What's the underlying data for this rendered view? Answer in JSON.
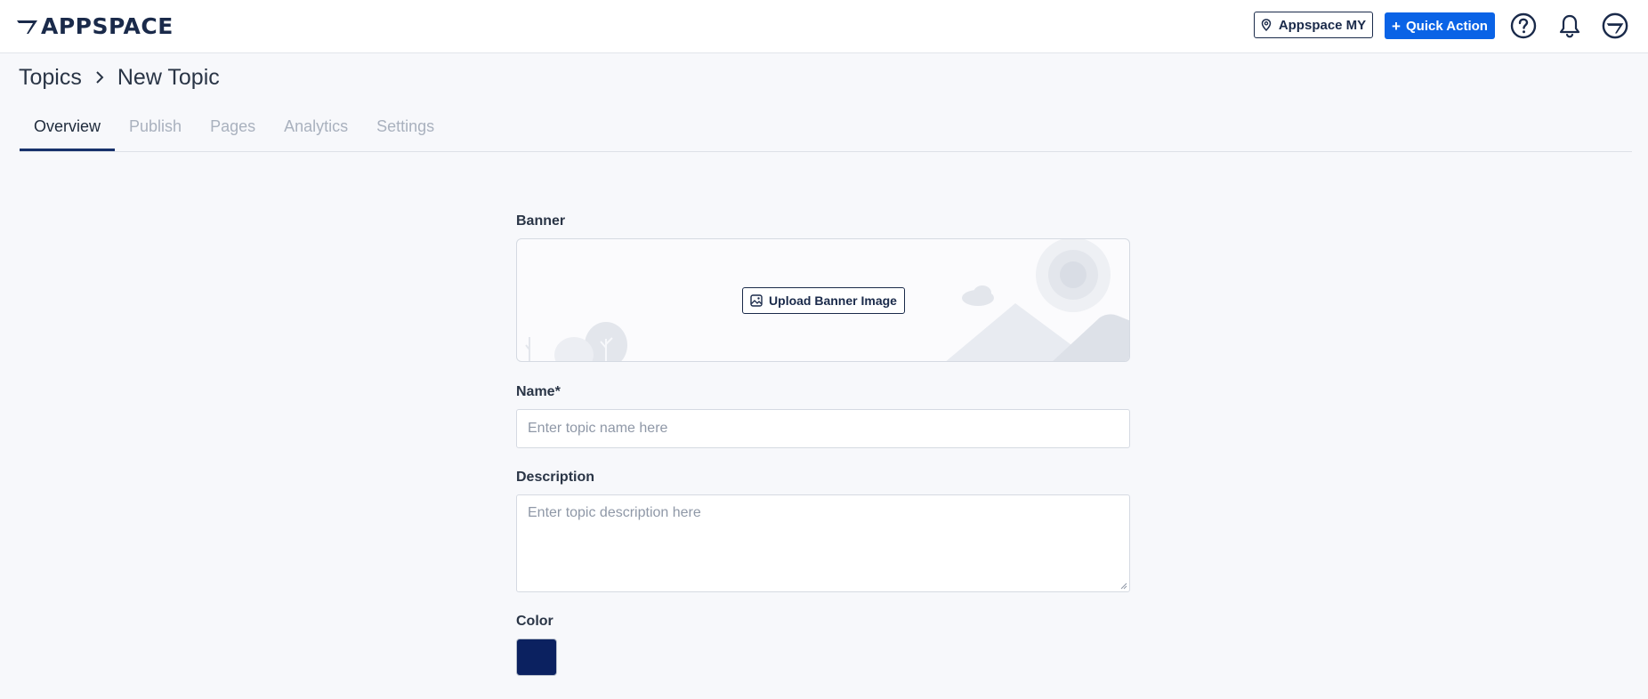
{
  "header": {
    "logo_text": "APPSPACE",
    "location_button": "Appspace MY",
    "quick_action_button": "Quick Action",
    "icons": [
      "help-icon",
      "bell-icon",
      "user-avatar-icon"
    ]
  },
  "breadcrumb": {
    "root": "Topics",
    "current": "New Topic"
  },
  "tabs": [
    {
      "label": "Overview",
      "active": true
    },
    {
      "label": "Publish",
      "active": false
    },
    {
      "label": "Pages",
      "active": false
    },
    {
      "label": "Analytics",
      "active": false
    },
    {
      "label": "Settings",
      "active": false
    }
  ],
  "form": {
    "banner": {
      "label": "Banner",
      "upload_button": "Upload Banner Image"
    },
    "name": {
      "label": "Name*",
      "placeholder": "Enter topic name here",
      "value": ""
    },
    "description": {
      "label": "Description",
      "placeholder": "Enter topic description here",
      "value": ""
    },
    "color": {
      "label": "Color",
      "value": "#0b2160"
    }
  },
  "colors": {
    "accent": "#0a63e6",
    "brand_dark": "#1a2a4a",
    "tab_underline": "#17316b"
  }
}
